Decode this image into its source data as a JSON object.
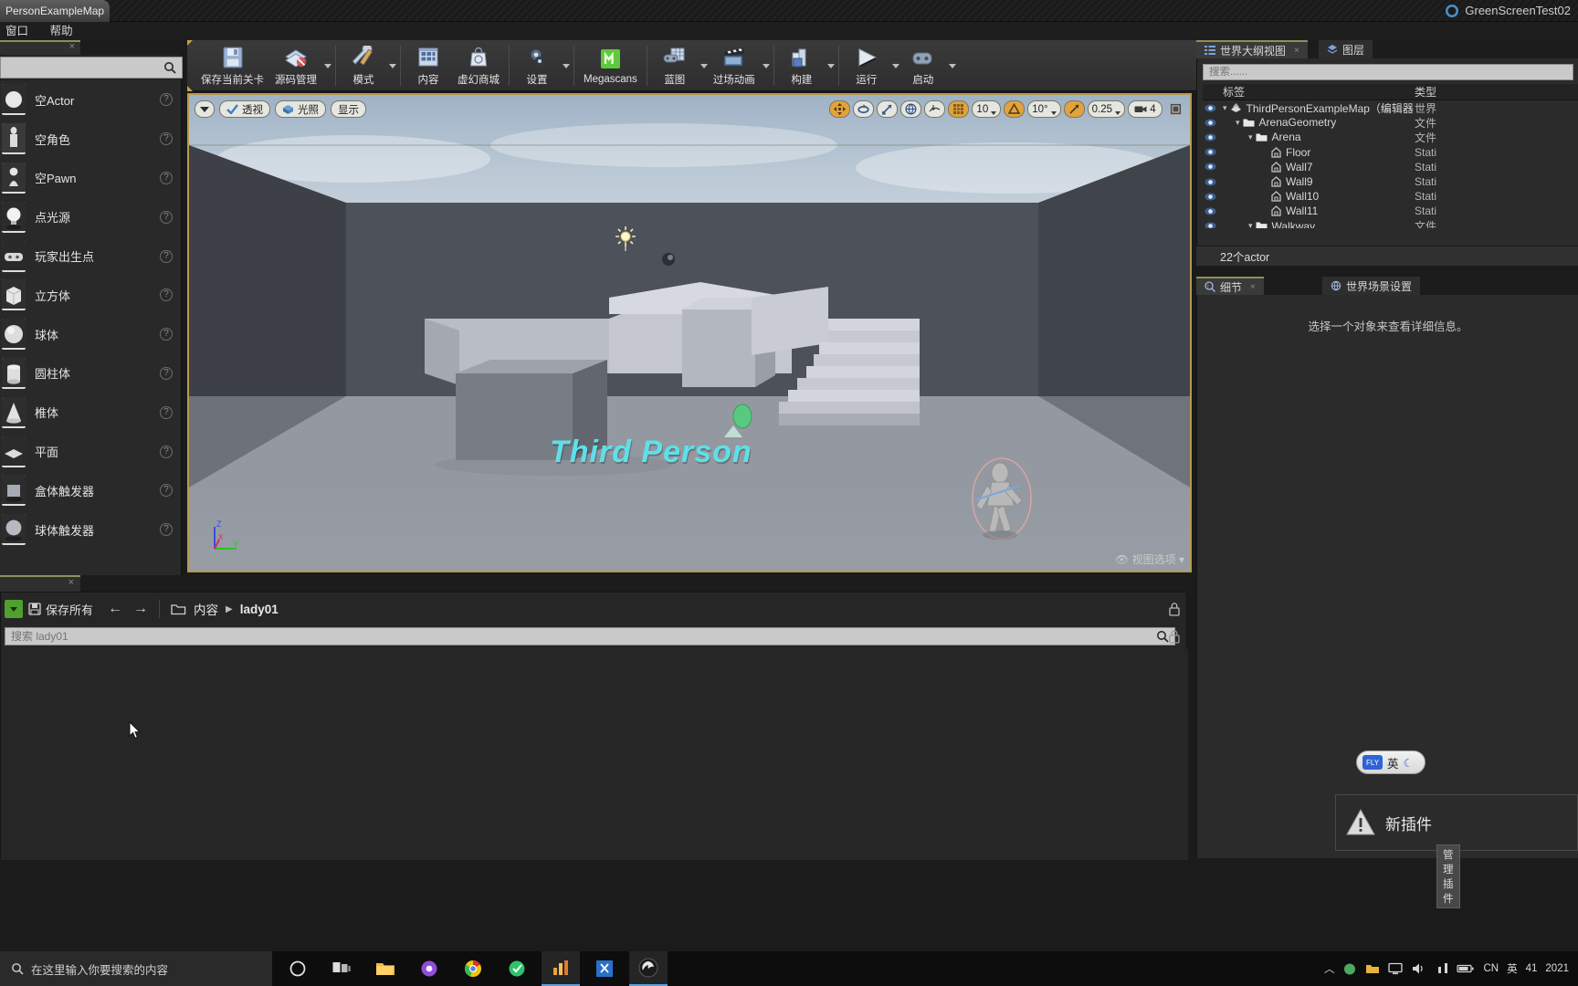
{
  "titlebar": {
    "tab_label": "PersonExampleMap",
    "right_title": "GreenScreenTest02",
    "ue_icon": "unreal-icon"
  },
  "menubar": {
    "items": [
      {
        "label": "窗口"
      },
      {
        "label": "帮助"
      }
    ]
  },
  "toolbar": {
    "items": [
      {
        "label": "保存当前关卡",
        "icon": "save-icon",
        "caret": false
      },
      {
        "label": "源码管理",
        "icon": "source-control-icon",
        "caret": true
      },
      {
        "label": "模式",
        "icon": "modes-wrench-icon",
        "caret": true
      },
      {
        "label": "内容",
        "icon": "content-grid-icon",
        "caret": false
      },
      {
        "label": "虚幻商城",
        "icon": "marketplace-bag-icon",
        "caret": false
      },
      {
        "label": "设置",
        "icon": "settings-gears-icon",
        "caret": true
      },
      {
        "label": "Megascans",
        "icon": "megascans-icon",
        "caret": false
      },
      {
        "label": "蓝图",
        "icon": "blueprint-icon",
        "caret": true
      },
      {
        "label": "过场动画",
        "icon": "cinematics-clapper-icon",
        "caret": true
      },
      {
        "label": "构建",
        "icon": "build-icon",
        "caret": true
      },
      {
        "label": "运行",
        "icon": "play-icon",
        "caret": true
      },
      {
        "label": "启动",
        "icon": "launch-icon",
        "caret": true
      }
    ]
  },
  "place_actors": {
    "tab_close": "×",
    "search_placeholder": "",
    "search_icon": "search-icon",
    "items": [
      {
        "label": "空Actor",
        "icon": "empty-actor-icon"
      },
      {
        "label": "空角色",
        "icon": "empty-character-icon"
      },
      {
        "label": "空Pawn",
        "icon": "empty-pawn-icon"
      },
      {
        "label": "点光源",
        "icon": "point-light-icon"
      },
      {
        "label": "玩家出生点",
        "icon": "player-start-icon"
      },
      {
        "label": "立方体",
        "icon": "cube-icon"
      },
      {
        "label": "球体",
        "icon": "sphere-icon"
      },
      {
        "label": "圆柱体",
        "icon": "cylinder-icon"
      },
      {
        "label": "椎体",
        "icon": "cone-icon"
      },
      {
        "label": "平面",
        "icon": "plane-icon"
      },
      {
        "label": "盒体触发器",
        "icon": "box-trigger-icon"
      },
      {
        "label": "球体触发器",
        "icon": "sphere-trigger-icon"
      }
    ],
    "help_glyph": "?"
  },
  "viewport": {
    "left_buttons": [
      {
        "label": "",
        "icon": "viewport-menu-caret-icon"
      },
      {
        "label": "透视",
        "icon": "perspective-icon"
      },
      {
        "label": "光照",
        "icon": "lit-icon"
      },
      {
        "label": "显示",
        "icon": "show-menu-icon"
      }
    ],
    "right_buttons": [
      {
        "label": "",
        "icon": "translate-mode-icon",
        "active": true
      },
      {
        "label": "",
        "icon": "rotate-mode-icon",
        "active": false
      },
      {
        "label": "",
        "icon": "scale-mode-icon",
        "active": false
      },
      {
        "label": "",
        "icon": "world-coords-icon",
        "active": false
      },
      {
        "label": "",
        "icon": "surface-snap-icon",
        "active": false
      },
      {
        "label": "",
        "icon": "grid-snap-icon",
        "active": true
      },
      {
        "label": "10",
        "icon": "grid-size-value",
        "active": false
      },
      {
        "label": "",
        "icon": "angle-snap-icon",
        "active": true
      },
      {
        "label": "10°",
        "icon": "angle-size-value",
        "active": false
      },
      {
        "label": "",
        "icon": "scale-snap-icon",
        "active": true
      },
      {
        "label": "0.25",
        "icon": "scale-size-value",
        "active": false
      },
      {
        "label": "4",
        "icon": "camera-speed-icon",
        "active": false
      },
      {
        "label": "",
        "icon": "maximize-viewport-icon",
        "active": false
      }
    ],
    "scene_title": "Third Person",
    "view_options": "视图选项",
    "gizmo_axes": [
      "Z",
      "Y",
      "X"
    ]
  },
  "content_browser": {
    "tab_close": "×",
    "save_all_label": "保存所有",
    "save_all_icon": "save-all-icon",
    "green_caret_icon": "add-new-caret-icon",
    "back_icon": "back-arrow-icon",
    "forward_icon": "forward-arrow-icon",
    "folder_icon": "folder-icon",
    "breadcrumb": [
      "内容",
      "lady01"
    ],
    "breadcrumb_sep": "▶",
    "search_placeholder": "搜索 lady01",
    "search_icon": "search-icon",
    "lock_icon": "lock-icon"
  },
  "right_panels": {
    "tabs": [
      {
        "label": "世界大纲视图",
        "icon": "outliner-icon",
        "selected": true
      },
      {
        "label": "图层",
        "icon": "layers-icon",
        "selected": false
      }
    ],
    "outliner": {
      "search_placeholder": "搜索......",
      "columns": [
        "标签",
        "类型"
      ],
      "rows": [
        {
          "name": "ThirdPersonExampleMap（编辑器",
          "type": "世界",
          "depth": 0,
          "icon": "level-icon",
          "expander": "▾"
        },
        {
          "name": "ArenaGeometry",
          "type": "文件",
          "depth": 1,
          "icon": "folder-icon",
          "expander": "▾"
        },
        {
          "name": "Arena",
          "type": "文件",
          "depth": 2,
          "icon": "folder-icon",
          "expander": "▾"
        },
        {
          "name": "Floor",
          "type": "Stati",
          "depth": 3,
          "icon": "actor-icon",
          "expander": ""
        },
        {
          "name": "Wall7",
          "type": "Stati",
          "depth": 3,
          "icon": "actor-icon",
          "expander": ""
        },
        {
          "name": "Wall9",
          "type": "Stati",
          "depth": 3,
          "icon": "actor-icon",
          "expander": ""
        },
        {
          "name": "Wall10",
          "type": "Stati",
          "depth": 3,
          "icon": "actor-icon",
          "expander": ""
        },
        {
          "name": "Wall11",
          "type": "Stati",
          "depth": 3,
          "icon": "actor-icon",
          "expander": ""
        },
        {
          "name": "Walkway",
          "type": "文件",
          "depth": 2,
          "icon": "folder-icon",
          "expander": "▾"
        }
      ],
      "eye_icon": "visibility-eye-icon",
      "footer": "22个actor"
    },
    "details": {
      "tabs": [
        {
          "label": "细节",
          "icon": "details-icon",
          "selected": true
        },
        {
          "label": "世界场景设置",
          "icon": "world-settings-icon",
          "selected": false
        }
      ],
      "empty_message": "选择一个对象来查看详细信息。"
    }
  },
  "ime": {
    "label": "英",
    "logo": "fly-ime-logo",
    "moon_icon": "moon-icon"
  },
  "plugin_toast": {
    "title": "新插件",
    "button": "管理插件",
    "icon": "warning-triangle-icon"
  },
  "taskbar": {
    "search_placeholder": "在这里输入你要搜索的内容",
    "search_icon": "windows-search-icon",
    "start_icon": "windows-start-icon",
    "items": [
      {
        "icon": "cortana-circle-icon",
        "active": false
      },
      {
        "icon": "task-view-icon",
        "active": false
      },
      {
        "icon": "file-explorer-icon",
        "active": false
      },
      {
        "icon": "media-app-icon",
        "active": false
      },
      {
        "icon": "chrome-icon",
        "active": false
      },
      {
        "icon": "green-app-icon",
        "active": false
      },
      {
        "icon": "orange-chart-app-icon",
        "active": true
      },
      {
        "icon": "vs-app-icon",
        "active": false
      },
      {
        "icon": "unreal-engine-icon",
        "active": true
      }
    ],
    "tray": {
      "chevron_icon": "chevron-up-icon",
      "icons": [
        "tray-app-icon",
        "tray-folder-icon",
        "tray-monitor-icon",
        "volume-icon",
        "network-icon",
        "battery-icon"
      ],
      "lang": "CN",
      "lang2": "英",
      "count": "41",
      "clock_line1": "2021"
    }
  }
}
